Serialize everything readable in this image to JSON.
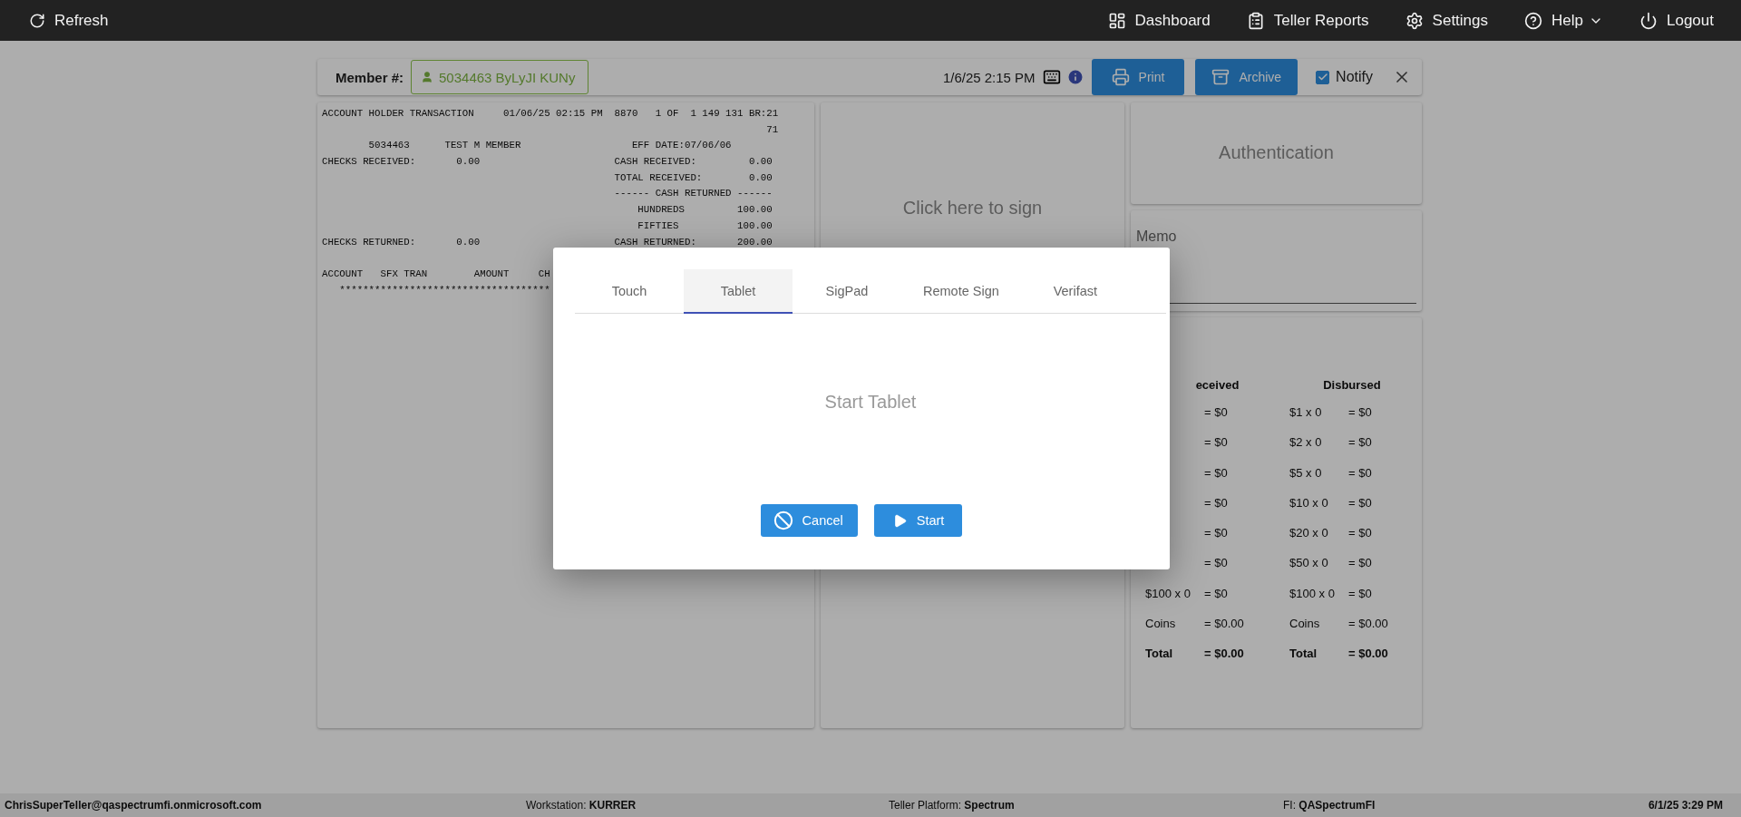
{
  "top_bar": {
    "refresh": {
      "label": "Refresh"
    },
    "nav": [
      {
        "kind": "dashboard",
        "label": "Dashboard",
        "menu": false
      },
      {
        "kind": "reports",
        "label": "Teller Reports",
        "menu": false
      },
      {
        "kind": "settings",
        "label": "Settings",
        "menu": false
      },
      {
        "kind": "help",
        "label": "Help",
        "menu": true
      },
      {
        "kind": "logout",
        "label": "Logout",
        "menu": false
      }
    ]
  },
  "header": {
    "member_label": "Member #:",
    "member_value": "5034463 ByLyJI KUNy",
    "timestamp": "1/6/25 2:15 PM",
    "buttons": [
      {
        "kind": "print",
        "label": "Print"
      },
      {
        "kind": "archive",
        "label": "Archive"
      }
    ],
    "notify": {
      "label": "Notify",
      "checked": true
    }
  },
  "receipt": {
    "sections": [
      {
        "lines": [
          "ACCOUNT HOLDER TRANSACTION     01/06/25 02:15 PM  8870   1 OF  1 149 131 BR:21",
          "                                                                            71",
          "        5034463      TEST M MEMBER                   EFF DATE:07/06/06",
          "CHECKS RECEIVED:       0.00                       CASH RECEIVED:         0.00",
          "                                                  TOTAL RECEIVED:        0.00",
          "                                                  ------ CASH RETURNED ------",
          "                                                      HUNDREDS         100.00",
          "                                                      FIFTIES          100.00",
          "CHECKS RETURNED:       0.00                       CASH RETURNED:       200.00"
        ]
      },
      {
        "lines": [
          "ACCOUNT   SFX TRAN        AMOUNT     CH",
          "   ************************************"
        ]
      }
    ]
  },
  "signature": {
    "prompt": "Click here to sign"
  },
  "authentication": {
    "title": "Authentication"
  },
  "memo": {
    "label": "Memo"
  },
  "cash": {
    "received_header": "eceived",
    "disbursed_header": "Disbursed",
    "rows": [
      {
        "kind": "denomination",
        "received_amount": "= $0",
        "disbursed_denomination": "$1 x 0",
        "disbursed_amount": "= $0"
      },
      {
        "kind": "denomination",
        "received_amount": "= $0",
        "disbursed_denomination": "$2 x 0",
        "disbursed_amount": "= $0"
      },
      {
        "kind": "denomination",
        "received_amount": "= $0",
        "disbursed_denomination": "$5 x 0",
        "disbursed_amount": "= $0"
      },
      {
        "kind": "denomination",
        "received_amount": "= $0",
        "disbursed_denomination": "$10 x 0",
        "disbursed_amount": "= $0"
      },
      {
        "kind": "denomination",
        "received_amount": "= $0",
        "disbursed_denomination": "$20 x 0",
        "disbursed_amount": "= $0"
      },
      {
        "kind": "denomination",
        "received_amount": "= $0",
        "disbursed_denomination": "$50 x 0",
        "disbursed_amount": "= $0"
      },
      {
        "kind": "denomination",
        "received_denomination": "$100 x 0",
        "received_amount": "= $0",
        "disbursed_denomination": "$100 x 0",
        "disbursed_amount": "= $0"
      },
      {
        "kind": "coins",
        "received_denomination": "Coins",
        "received_amount": "= $0.00",
        "disbursed_denomination": "Coins",
        "disbursed_amount": "= $0.00"
      },
      {
        "kind": "total",
        "received_denomination": "Total",
        "received_amount": "= $0.00",
        "disbursed_denomination": "Total",
        "disbursed_amount": "= $0.00"
      }
    ]
  },
  "status_bar": {
    "user": "ChrisSuperTeller@qaspectrumfi.onmicrosoft.com",
    "workstation": "Workstation: **KURRER**",
    "platform": "Teller Platform: **Spectrum**",
    "fi": "FI: **QASpectrumFI**",
    "datetime": "6/1/25 3:29 PM"
  },
  "modal": {
    "tabs": [
      {
        "label": "Touch",
        "selected": false
      },
      {
        "label": "Tablet",
        "selected": true
      },
      {
        "label": "SigPad",
        "selected": false
      },
      {
        "label": "Remote Sign",
        "selected": false
      },
      {
        "label": "Verifast",
        "selected": false
      }
    ],
    "message": "Start Tablet",
    "buttons": [
      {
        "kind": "cancel",
        "label": "Cancel"
      },
      {
        "kind": "start",
        "label": "Start"
      }
    ]
  }
}
